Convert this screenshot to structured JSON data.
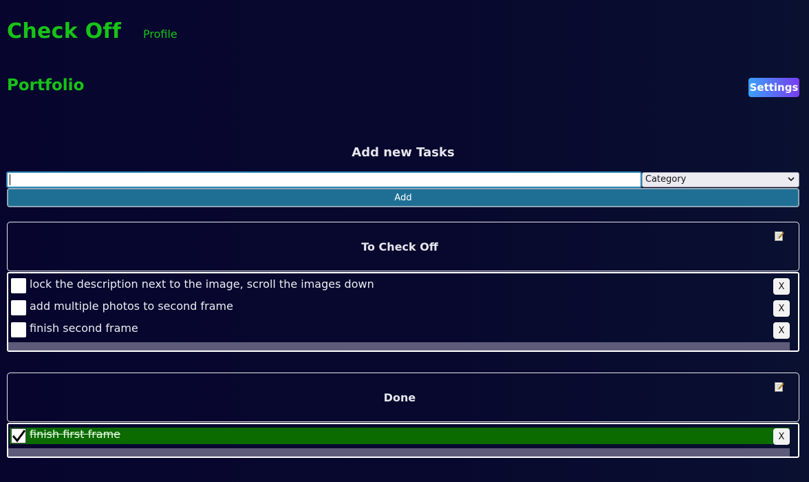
{
  "header": {
    "app_title": "Check Off",
    "nav_profile": "Profile"
  },
  "section": {
    "title": "Portfolio",
    "settings_label": "Settings"
  },
  "add_form": {
    "heading": "Add new Tasks",
    "task_value": "",
    "category_selected": "Category",
    "add_label": "Add"
  },
  "todo_panel": {
    "title": "To Check Off",
    "edit_icon": "edit-note-icon",
    "tasks": [
      {
        "text": "lock the description next to the image, scroll the images down",
        "checked": false,
        "delete_label": "X"
      },
      {
        "text": "add multiple photos to second frame",
        "checked": false,
        "delete_label": "X"
      },
      {
        "text": "finish second frame",
        "checked": false,
        "delete_label": "X"
      }
    ]
  },
  "done_panel": {
    "title": "Done",
    "edit_icon": "edit-note-icon",
    "tasks": [
      {
        "text": "finish first frame",
        "checked": true,
        "delete_label": "X"
      }
    ]
  },
  "colors": {
    "accent_green": "#17c317",
    "done_row": "#0b6a00",
    "add_button": "#1f6f94"
  }
}
